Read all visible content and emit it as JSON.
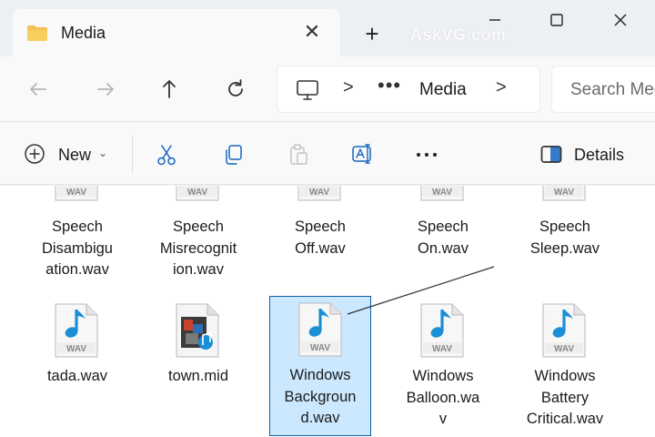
{
  "window": {
    "tab_title": "Media",
    "watermark": "AskVG.com"
  },
  "address_bar": {
    "location": "Media",
    "overflow": "•••",
    "separator": ">"
  },
  "search": {
    "placeholder": "Search Media"
  },
  "command_bar": {
    "new_label": "New",
    "new_chevron": "⌄",
    "details_label": "Details"
  },
  "files": [
    {
      "name": "Speech Disambiguation.wav",
      "lines": [
        "Speech",
        "Disambigu",
        "ation.wav"
      ],
      "type": "WAV"
    },
    {
      "name": "Speech Misrecognition.wav",
      "lines": [
        "Speech",
        "Misrecognit",
        "ion.wav"
      ],
      "type": "WAV"
    },
    {
      "name": "Speech Off.wav",
      "lines": [
        "Speech",
        "Off.wav"
      ],
      "type": "WAV"
    },
    {
      "name": "Speech On.wav",
      "lines": [
        "Speech",
        "On.wav"
      ],
      "type": "WAV"
    },
    {
      "name": "Speech Sleep.wav",
      "lines": [
        "Speech",
        "Sleep.wav"
      ],
      "type": "WAV"
    },
    {
      "name": "tada.wav",
      "lines": [
        "tada.wav"
      ],
      "type": "WAV"
    },
    {
      "name": "town.mid",
      "lines": [
        "town.mid"
      ],
      "type": "MID"
    },
    {
      "name": "Windows Background.wav",
      "lines": [
        "Windows",
        "Backgroun",
        "d.wav"
      ],
      "type": "WAV",
      "selected": true
    },
    {
      "name": "Windows Balloon.wav",
      "lines": [
        "Windows",
        "Balloon.wa",
        "v"
      ],
      "type": "WAV"
    },
    {
      "name": "Windows Battery Critical.wav",
      "lines": [
        "Windows",
        "Battery",
        "Critical.wav"
      ],
      "type": "WAV"
    }
  ],
  "colors": {
    "selection_fill": "#cce8ff",
    "selection_border": "#0f5fa8",
    "music_note": "#1a8fd6",
    "folder": "#f2c14e"
  }
}
